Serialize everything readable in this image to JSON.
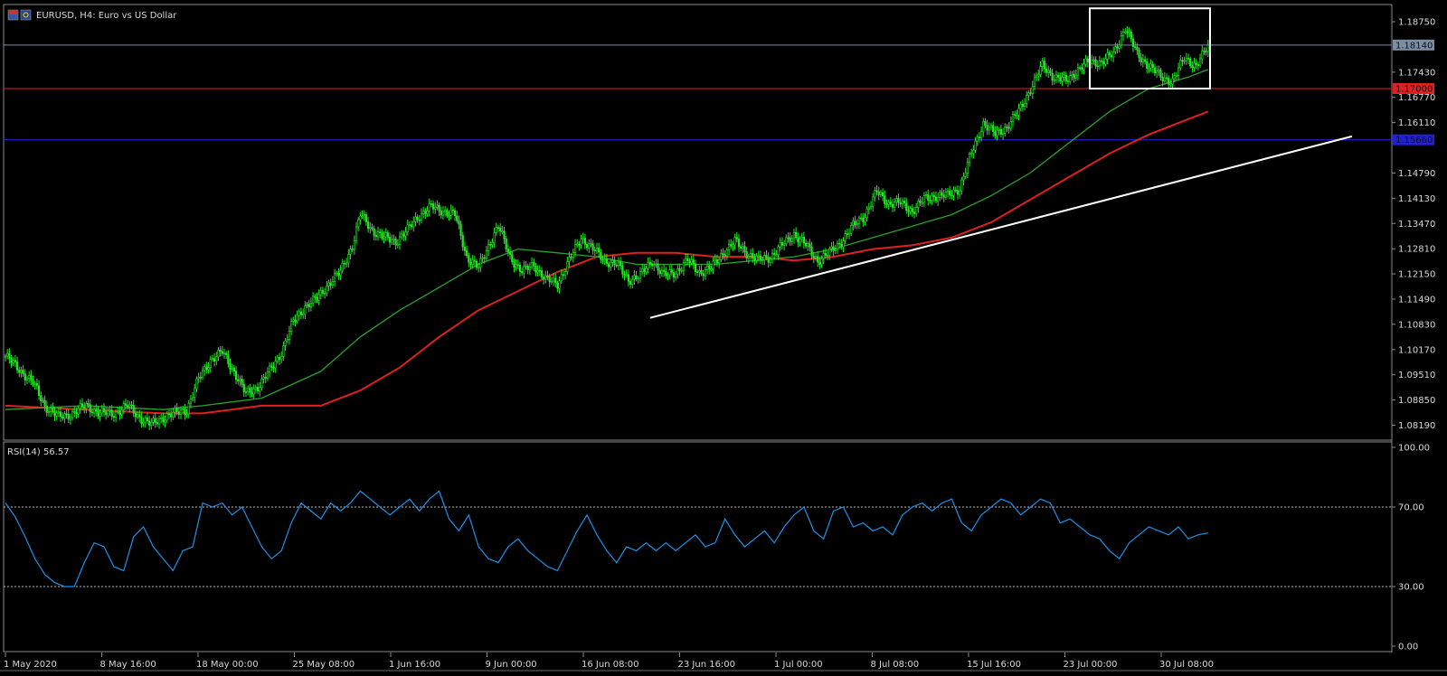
{
  "chart_title": "EURUSD, H4:  Euro vs US Dollar",
  "chart_data": [
    {
      "type": "candlestick",
      "symbol": "EURUSD",
      "timeframe": "H4",
      "title": "EURUSD, H4:  Euro vs US Dollar",
      "ylim": [
        1.078,
        1.192
      ],
      "y_ticks": [
        "1.18750",
        "1.17430",
        "1.16770",
        "1.16110",
        "1.14790",
        "1.14130",
        "1.13470",
        "1.12810",
        "1.12150",
        "1.11490",
        "1.10830",
        "1.10170",
        "1.09510",
        "1.08850",
        "1.08190"
      ],
      "x_ticks": [
        "1 May 2020",
        "8 May 16:00",
        "18 May 00:00",
        "25 May 08:00",
        "1 Jun 16:00",
        "9 Jun 00:00",
        "16 Jun 08:00",
        "23 Jun 16:00",
        "1 Jul 00:00",
        "8 Jul 08:00",
        "15 Jul 16:00",
        "23 Jul 00:00",
        "30 Jul 08:00"
      ],
      "close_path": [
        [
          0,
          1.1
        ],
        [
          8,
          1.096
        ],
        [
          14,
          1.093
        ],
        [
          20,
          1.087
        ],
        [
          27,
          1.084
        ],
        [
          34,
          1.085
        ],
        [
          41,
          1.087
        ],
        [
          48,
          1.085
        ],
        [
          55,
          1.085
        ],
        [
          62,
          1.087
        ],
        [
          68,
          1.084
        ],
        [
          74,
          1.082
        ],
        [
          80,
          1.084
        ],
        [
          86,
          1.085
        ],
        [
          92,
          1.086
        ],
        [
          98,
          1.094
        ],
        [
          104,
          1.099
        ],
        [
          110,
          1.101
        ],
        [
          116,
          1.096
        ],
        [
          122,
          1.09
        ],
        [
          128,
          1.092
        ],
        [
          134,
          1.096
        ],
        [
          140,
          1.101
        ],
        [
          146,
          1.109
        ],
        [
          152,
          1.113
        ],
        [
          158,
          1.115
        ],
        [
          164,
          1.119
        ],
        [
          170,
          1.122
        ],
        [
          176,
          1.129
        ],
        [
          180,
          1.137
        ],
        [
          186,
          1.133
        ],
        [
          192,
          1.131
        ],
        [
          198,
          1.13
        ],
        [
          204,
          1.133
        ],
        [
          210,
          1.137
        ],
        [
          216,
          1.139
        ],
        [
          222,
          1.138
        ],
        [
          228,
          1.137
        ],
        [
          234,
          1.126
        ],
        [
          240,
          1.123
        ],
        [
          246,
          1.13
        ],
        [
          250,
          1.134
        ],
        [
          256,
          1.126
        ],
        [
          262,
          1.122
        ],
        [
          268,
          1.124
        ],
        [
          274,
          1.12
        ],
        [
          280,
          1.119
        ],
        [
          286,
          1.125
        ],
        [
          292,
          1.131
        ],
        [
          298,
          1.128
        ],
        [
          304,
          1.125
        ],
        [
          310,
          1.124
        ],
        [
          316,
          1.12
        ],
        [
          322,
          1.121
        ],
        [
          328,
          1.125
        ],
        [
          334,
          1.121
        ],
        [
          340,
          1.122
        ],
        [
          346,
          1.125
        ],
        [
          352,
          1.122
        ],
        [
          358,
          1.123
        ],
        [
          364,
          1.127
        ],
        [
          370,
          1.13
        ],
        [
          376,
          1.127
        ],
        [
          382,
          1.125
        ],
        [
          388,
          1.126
        ],
        [
          394,
          1.129
        ],
        [
          400,
          1.132
        ],
        [
          406,
          1.129
        ],
        [
          412,
          1.125
        ],
        [
          418,
          1.127
        ],
        [
          424,
          1.13
        ],
        [
          430,
          1.134
        ],
        [
          436,
          1.137
        ],
        [
          442,
          1.143
        ],
        [
          448,
          1.14
        ],
        [
          454,
          1.14
        ],
        [
          460,
          1.138
        ],
        [
          466,
          1.141
        ],
        [
          472,
          1.142
        ],
        [
          478,
          1.142
        ],
        [
          484,
          1.144
        ],
        [
          490,
          1.153
        ],
        [
          496,
          1.161
        ],
        [
          502,
          1.158
        ],
        [
          508,
          1.16
        ],
        [
          514,
          1.164
        ],
        [
          520,
          1.17
        ],
        [
          526,
          1.176
        ],
        [
          532,
          1.173
        ],
        [
          538,
          1.172
        ],
        [
          544,
          1.175
        ],
        [
          550,
          1.177
        ],
        [
          556,
          1.177
        ],
        [
          562,
          1.179
        ],
        [
          568,
          1.186
        ],
        [
          574,
          1.179
        ],
        [
          580,
          1.176
        ],
        [
          586,
          1.173
        ],
        [
          592,
          1.172
        ],
        [
          598,
          1.178
        ],
        [
          604,
          1.176
        ],
        [
          610,
          1.181
        ]
      ],
      "ma_fast": [
        [
          0,
          1.086
        ],
        [
          40,
          1.087
        ],
        [
          80,
          1.086
        ],
        [
          100,
          1.087
        ],
        [
          130,
          1.089
        ],
        [
          160,
          1.096
        ],
        [
          180,
          1.105
        ],
        [
          200,
          1.112
        ],
        [
          220,
          1.118
        ],
        [
          240,
          1.124
        ],
        [
          260,
          1.128
        ],
        [
          280,
          1.127
        ],
        [
          300,
          1.126
        ],
        [
          320,
          1.124
        ],
        [
          340,
          1.124
        ],
        [
          360,
          1.124
        ],
        [
          380,
          1.125
        ],
        [
          400,
          1.126
        ],
        [
          420,
          1.128
        ],
        [
          440,
          1.131
        ],
        [
          460,
          1.134
        ],
        [
          480,
          1.137
        ],
        [
          500,
          1.142
        ],
        [
          520,
          1.148
        ],
        [
          540,
          1.156
        ],
        [
          560,
          1.164
        ],
        [
          580,
          1.17
        ],
        [
          600,
          1.173
        ],
        [
          610,
          1.175
        ]
      ],
      "ma_slow": [
        [
          0,
          1.087
        ],
        [
          40,
          1.086
        ],
        [
          80,
          1.085
        ],
        [
          100,
          1.085
        ],
        [
          130,
          1.087
        ],
        [
          160,
          1.087
        ],
        [
          180,
          1.091
        ],
        [
          200,
          1.097
        ],
        [
          220,
          1.105
        ],
        [
          240,
          1.112
        ],
        [
          260,
          1.117
        ],
        [
          280,
          1.122
        ],
        [
          300,
          1.126
        ],
        [
          320,
          1.127
        ],
        [
          340,
          1.127
        ],
        [
          360,
          1.126
        ],
        [
          380,
          1.126
        ],
        [
          400,
          1.125
        ],
        [
          420,
          1.126
        ],
        [
          440,
          1.128
        ],
        [
          460,
          1.129
        ],
        [
          480,
          1.131
        ],
        [
          500,
          1.135
        ],
        [
          520,
          1.141
        ],
        [
          540,
          1.147
        ],
        [
          560,
          1.153
        ],
        [
          580,
          1.158
        ],
        [
          600,
          1.162
        ],
        [
          610,
          1.164
        ]
      ],
      "trendline": {
        "x": [
          327,
          683
        ],
        "y": [
          1.11,
          1.1575
        ]
      },
      "horizontal_lines": [
        {
          "price": 1.1814,
          "label": "1.18140",
          "color": "#7a8ea6"
        },
        {
          "price": 1.17,
          "label": "1.17000",
          "color": "#e02020"
        },
        {
          "price": 1.1566,
          "label": "1.15660",
          "color": "#2222cc"
        }
      ],
      "rectangle": {
        "x": [
          550,
          611
        ],
        "y": [
          1.17,
          1.191
        ]
      },
      "colors": {
        "candle": "#26e626",
        "ma_fast": "#2aa12a",
        "ma_slow": "#e02020",
        "trendline": "#ffffff",
        "grid": "#000000"
      },
      "grid": false
    },
    {
      "type": "line",
      "title": "RSI(14) 56.57",
      "indicator": "RSI(14)",
      "current_value": 56.57,
      "ylim": [
        0,
        100
      ],
      "y_ticks": [
        "100.00",
        "70.00",
        "30.00",
        "0.00"
      ],
      "levels": [
        70,
        30
      ],
      "color": "#1e90e6",
      "values": [
        [
          0,
          72
        ],
        [
          5,
          65
        ],
        [
          10,
          55
        ],
        [
          15,
          44
        ],
        [
          20,
          36
        ],
        [
          25,
          32
        ],
        [
          30,
          30
        ],
        [
          35,
          30
        ],
        [
          40,
          42
        ],
        [
          45,
          52
        ],
        [
          50,
          50
        ],
        [
          55,
          40
        ],
        [
          60,
          38
        ],
        [
          65,
          55
        ],
        [
          70,
          60
        ],
        [
          75,
          50
        ],
        [
          80,
          44
        ],
        [
          85,
          38
        ],
        [
          90,
          48
        ],
        [
          95,
          50
        ],
        [
          100,
          72
        ],
        [
          105,
          70
        ],
        [
          110,
          72
        ],
        [
          115,
          66
        ],
        [
          120,
          70
        ],
        [
          125,
          60
        ],
        [
          130,
          50
        ],
        [
          135,
          44
        ],
        [
          140,
          48
        ],
        [
          145,
          62
        ],
        [
          150,
          72
        ],
        [
          155,
          68
        ],
        [
          160,
          64
        ],
        [
          165,
          72
        ],
        [
          170,
          68
        ],
        [
          175,
          72
        ],
        [
          180,
          78
        ],
        [
          185,
          74
        ],
        [
          190,
          70
        ],
        [
          195,
          66
        ],
        [
          200,
          70
        ],
        [
          205,
          74
        ],
        [
          210,
          68
        ],
        [
          215,
          74
        ],
        [
          220,
          78
        ],
        [
          225,
          64
        ],
        [
          230,
          58
        ],
        [
          235,
          66
        ],
        [
          240,
          50
        ],
        [
          245,
          44
        ],
        [
          250,
          42
        ],
        [
          255,
          50
        ],
        [
          260,
          54
        ],
        [
          265,
          48
        ],
        [
          270,
          44
        ],
        [
          275,
          40
        ],
        [
          280,
          38
        ],
        [
          285,
          48
        ],
        [
          290,
          58
        ],
        [
          295,
          66
        ],
        [
          300,
          56
        ],
        [
          305,
          48
        ],
        [
          310,
          42
        ],
        [
          315,
          50
        ],
        [
          320,
          48
        ],
        [
          325,
          52
        ],
        [
          330,
          48
        ],
        [
          335,
          52
        ],
        [
          340,
          48
        ],
        [
          345,
          52
        ],
        [
          350,
          56
        ],
        [
          355,
          50
        ],
        [
          360,
          52
        ],
        [
          365,
          64
        ],
        [
          370,
          56
        ],
        [
          375,
          50
        ],
        [
          380,
          54
        ],
        [
          385,
          58
        ],
        [
          390,
          52
        ],
        [
          395,
          60
        ],
        [
          400,
          66
        ],
        [
          405,
          70
        ],
        [
          410,
          58
        ],
        [
          415,
          54
        ],
        [
          420,
          68
        ],
        [
          425,
          70
        ],
        [
          430,
          60
        ],
        [
          435,
          62
        ],
        [
          440,
          58
        ],
        [
          445,
          60
        ],
        [
          450,
          56
        ],
        [
          455,
          66
        ],
        [
          460,
          70
        ],
        [
          465,
          72
        ],
        [
          470,
          68
        ],
        [
          475,
          72
        ],
        [
          480,
          74
        ],
        [
          485,
          62
        ],
        [
          490,
          58
        ],
        [
          495,
          66
        ],
        [
          500,
          70
        ],
        [
          505,
          74
        ],
        [
          510,
          72
        ],
        [
          515,
          66
        ],
        [
          520,
          70
        ],
        [
          525,
          74
        ],
        [
          530,
          72
        ],
        [
          535,
          62
        ],
        [
          540,
          64
        ],
        [
          545,
          60
        ],
        [
          550,
          56
        ],
        [
          555,
          54
        ],
        [
          560,
          48
        ],
        [
          565,
          44
        ],
        [
          570,
          52
        ],
        [
          575,
          56
        ],
        [
          580,
          60
        ],
        [
          585,
          58
        ],
        [
          590,
          56
        ],
        [
          595,
          60
        ],
        [
          600,
          54
        ],
        [
          605,
          56
        ],
        [
          610,
          57
        ]
      ]
    }
  ]
}
